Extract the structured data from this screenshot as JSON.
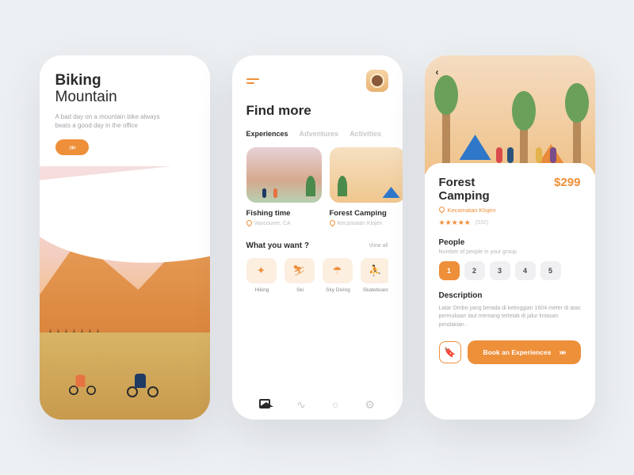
{
  "colors": {
    "accent": "#ee8f3a"
  },
  "screen1": {
    "title_line1": "Biking",
    "title_line2": "Mountain",
    "subtitle": "A bad day on a mountain bike always beats a good day in the office",
    "cta_icon": "»»"
  },
  "screen2": {
    "title": "Find more",
    "tabs": [
      "Experiences",
      "Adventures",
      "Activities"
    ],
    "active_tab_index": 0,
    "cards": [
      {
        "title": "Fishing time",
        "location": "Vancouver, CA"
      },
      {
        "title": "Forest Camping",
        "location": "Kecamatan Klojen"
      }
    ],
    "want_heading": "What you want ?",
    "view_all_label": "View all",
    "categories": [
      {
        "icon": "✦",
        "label": "Hiking"
      },
      {
        "icon": "⛷",
        "label": "Ski"
      },
      {
        "icon": "☂",
        "label": "Sky Diving"
      },
      {
        "icon": "⛹",
        "label": "Skateboard"
      }
    ]
  },
  "screen3": {
    "back_icon": "‹",
    "name": "Forest Camping",
    "price": "$299",
    "location": "Kecamatan Klojen",
    "rating_stars": "★★★★★",
    "rating_count": "(532)",
    "people_heading": "People",
    "people_sub": "Number of people in your group",
    "people_options": [
      "1",
      "2",
      "3",
      "4",
      "5"
    ],
    "people_selected_index": 0,
    "desc_heading": "Description",
    "description": "Latar Ombo yang berada di ketinggian 1604 meter di atas permukaan laut memang terletak di jalur lintasan pendakian .",
    "bookmark_glyph": "🔖",
    "book_label": "Book an Experiences",
    "book_chev": "»»"
  }
}
